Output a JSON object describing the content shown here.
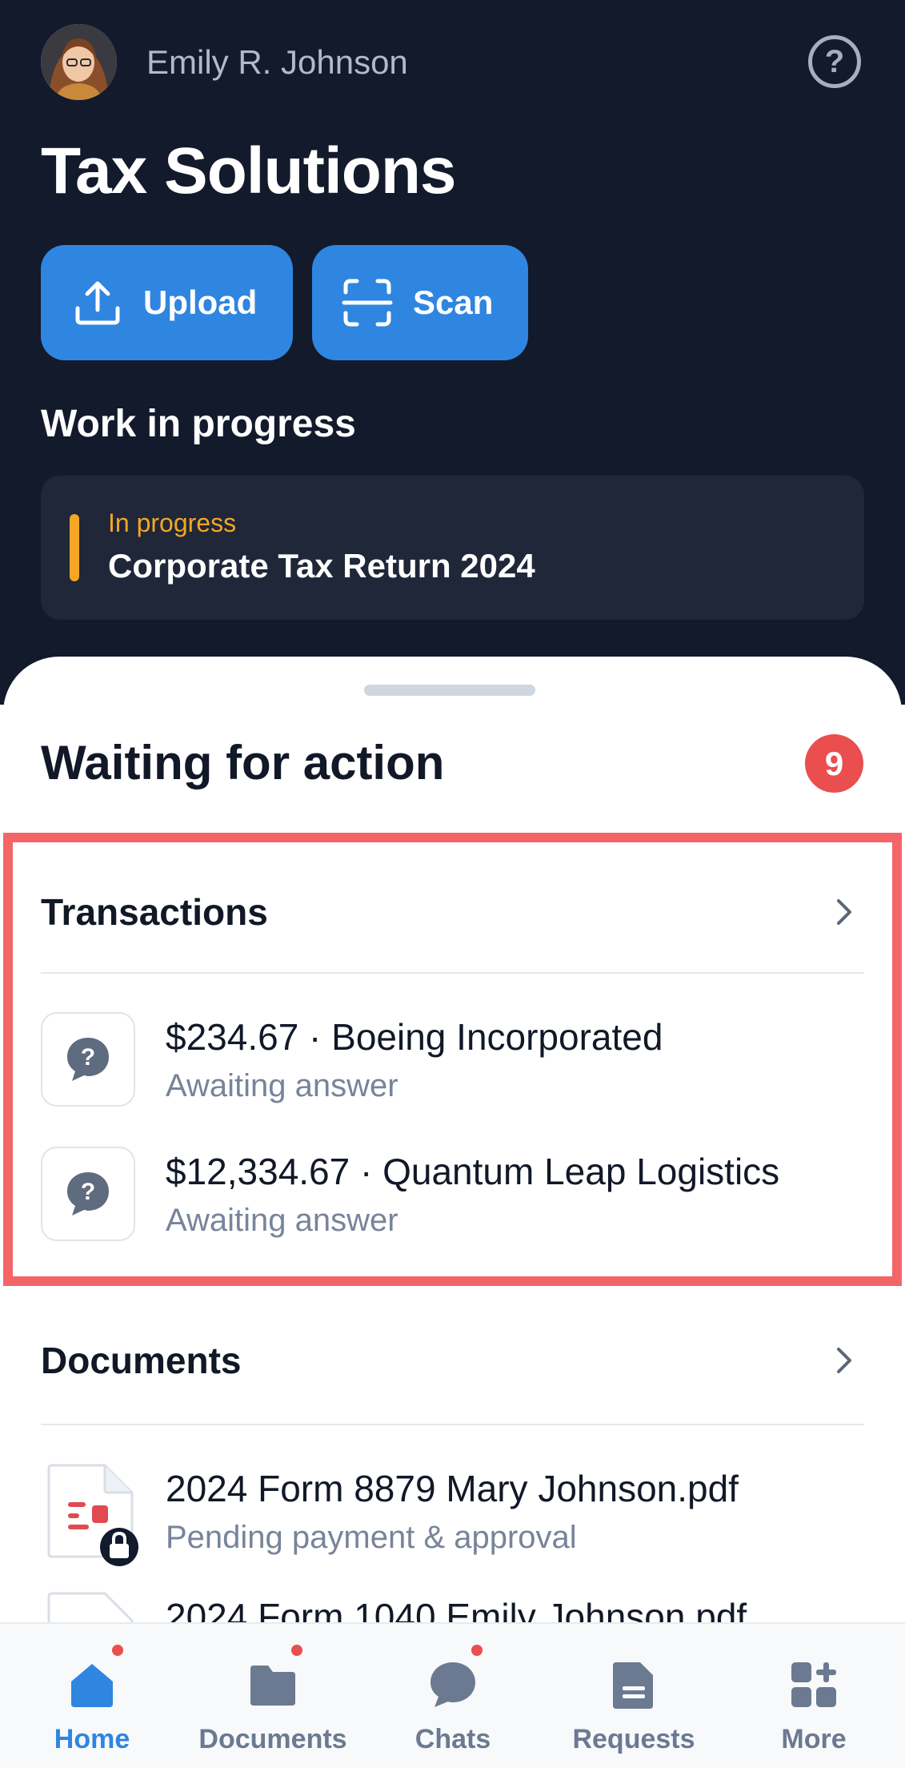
{
  "header": {
    "user_name": "Emily R. Johnson",
    "app_title": "Tax Solutions",
    "buttons": {
      "upload_label": "Upload",
      "scan_label": "Scan"
    },
    "work_in_progress": {
      "heading": "Work in progress",
      "item": {
        "status": "In progress",
        "title": "Corporate Tax Return 2024"
      }
    }
  },
  "waiting": {
    "title": "Waiting for action",
    "count": "9"
  },
  "transactions": {
    "title": "Transactions",
    "items": [
      {
        "title": "$234.67 · Boeing Incorporated",
        "status": "Awaiting answer"
      },
      {
        "title": "$12,334.67 · Quantum Leap Logistics",
        "status": "Awaiting answer"
      }
    ]
  },
  "documents": {
    "title": "Documents",
    "items": [
      {
        "title": "2024 Form 8879 Mary Johnson.pdf",
        "status": "Pending payment & approval"
      },
      {
        "title": "2024 Form 1040 Emily Johnson.pdf"
      }
    ]
  },
  "tabs": [
    {
      "label": "Home",
      "icon": "home-icon",
      "active": true
    },
    {
      "label": "Documents",
      "icon": "folder-icon"
    },
    {
      "label": "Chats",
      "icon": "chat-icon"
    },
    {
      "label": "Requests",
      "icon": "document-icon"
    },
    {
      "label": "More",
      "icon": "grid-plus-icon"
    }
  ],
  "colors": {
    "header_bg": "#121a2c",
    "accent": "#2e86e0",
    "in_progress": "#f5a623",
    "badge": "#ea4e4f",
    "highlight": "#f36567"
  }
}
